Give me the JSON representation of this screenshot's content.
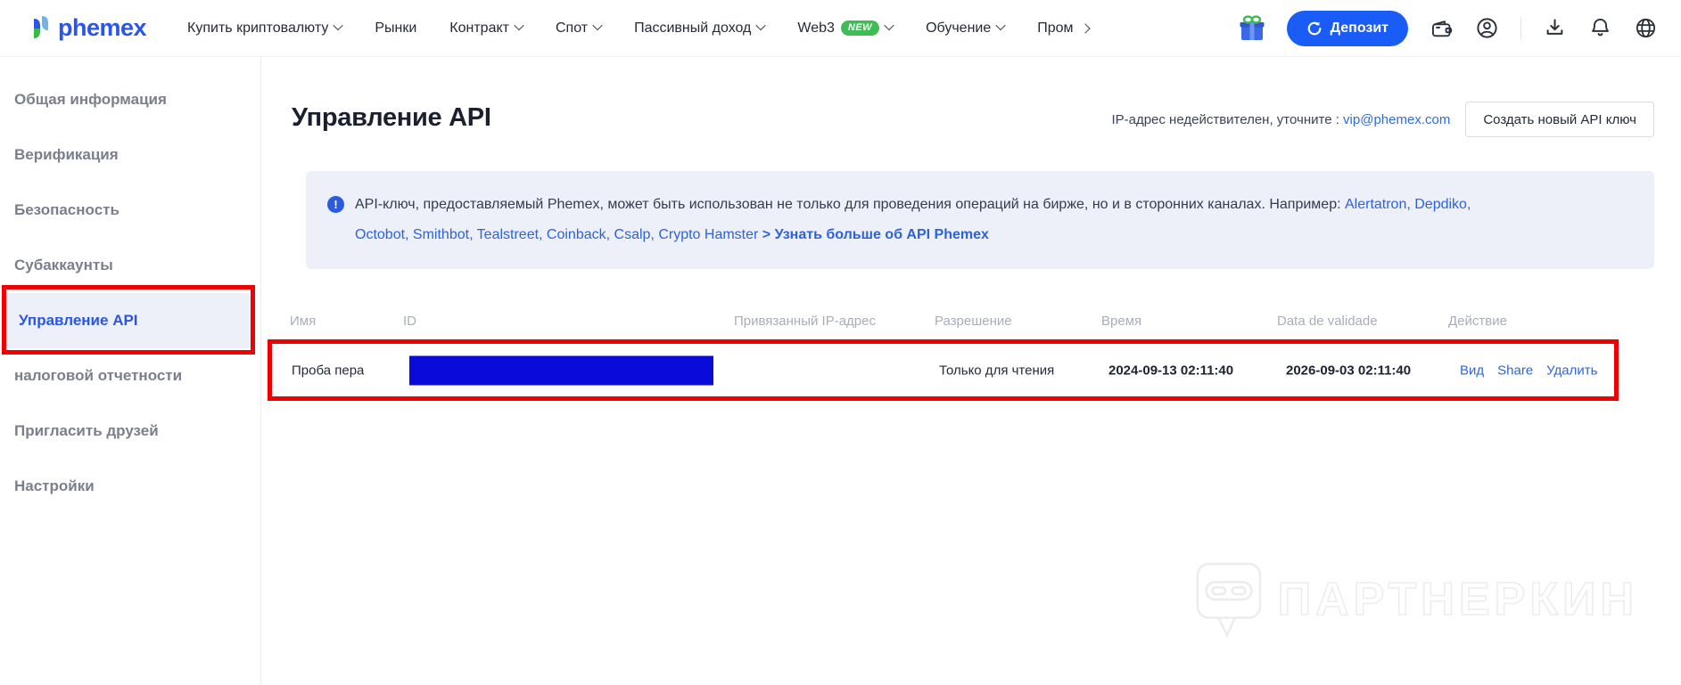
{
  "header": {
    "logo_text": "phemex",
    "nav": [
      {
        "label": "Купить криптовалюту",
        "dropdown": true
      },
      {
        "label": "Рынки",
        "dropdown": false
      },
      {
        "label": "Контракт",
        "dropdown": true
      },
      {
        "label": "Спот",
        "dropdown": true
      },
      {
        "label": "Пассивный доход",
        "dropdown": true
      },
      {
        "label": "Web3",
        "badge": "NEW",
        "dropdown": true
      },
      {
        "label": "Обучение",
        "dropdown": true
      },
      {
        "label": "Пром",
        "arrow": "right"
      }
    ],
    "deposit_button": "Депозит",
    "icons": [
      "gift-icon",
      "wallet-icon",
      "profile-icon",
      "download-icon",
      "bell-icon",
      "globe-icon"
    ]
  },
  "sidebar": {
    "items": [
      {
        "label": "Общая информация",
        "active": false
      },
      {
        "label": "Верификация",
        "active": false
      },
      {
        "label": "Безопасность",
        "active": false
      },
      {
        "label": "Субаккаунты",
        "active": false
      },
      {
        "label": "Управление API",
        "active": true
      },
      {
        "label": "налоговой отчетности",
        "active": false
      },
      {
        "label": "Пригласить друзей",
        "active": false
      },
      {
        "label": "Настройки",
        "active": false
      }
    ]
  },
  "main": {
    "title": "Управление API",
    "ip_note_text": "IP-адрес недействителен, уточните : ",
    "ip_note_email": "vip@phemex.com",
    "create_button": "Создать новый API ключ",
    "banner": {
      "line1_dark": "API-ключ, предоставляемый Phemex, может быть использован не только для проведения операций на бирже, но и в сторонних каналах. Например: ",
      "line1_links": "Alertatron, Depdiko,",
      "line2_links": "Octobot, Smithbot, Tealstreet, Coinback, Csalp, Crypto Hamster ",
      "line2_more": "> Узнать больше об API Phemex"
    },
    "table": {
      "headers": [
        "Имя",
        "ID",
        "Привязанный IP-адрес",
        "Разрешение",
        "Время",
        "Data de validade",
        "Действие"
      ],
      "row": {
        "name": "Проба пера",
        "id_redacted": true,
        "bound_ip": "",
        "permission": "Только для чтения",
        "time": "2024-09-13 02:11:40",
        "validity": "2026-09-03 02:11:40",
        "actions": [
          "Вид",
          "Share",
          "Удалить"
        ]
      }
    }
  },
  "watermark_text": "ПАРТНЕРКИН",
  "colors": {
    "accent_blue": "#1a5cf7",
    "link_blue": "#2d62dd",
    "highlight_red": "#ee0103",
    "redaction_blue": "#0b0bd9",
    "badge_green": "#3fbd55",
    "active_item_bg": "#edeff9",
    "banner_bg": "#eef0f9"
  }
}
